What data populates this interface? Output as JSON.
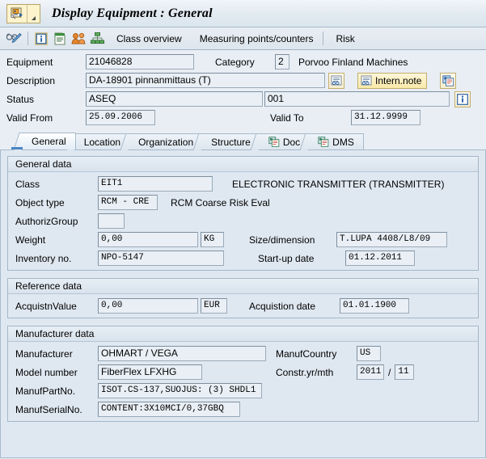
{
  "window": {
    "title": "Display Equipment : General",
    "system_icon": "sap-equipment-icon",
    "menu_arrow": "chevron-down-icon"
  },
  "toolbar": {
    "icons": [
      {
        "name": "glasses-pencil-icon",
        "label": "Display/Change"
      },
      {
        "name": "info-icon",
        "label": "Information"
      },
      {
        "name": "list-icon",
        "label": "List"
      },
      {
        "name": "partners-icon",
        "label": "Partners"
      },
      {
        "name": "structure-icon",
        "label": "Structure"
      }
    ],
    "buttons": [
      {
        "name": "class-overview-button",
        "label": "Class overview"
      },
      {
        "name": "measuring-points-button",
        "label": "Measuring points/counters"
      },
      {
        "name": "risk-button",
        "label": "Risk"
      }
    ]
  },
  "header": {
    "equipment_label": "Equipment",
    "equipment_value": "21046828",
    "category_label": "Category",
    "category_value": "2",
    "category_text": "Porvoo Finland Machines",
    "description_label": "Description",
    "description_value": "DA-18901 pinnanmittaus (T)",
    "description_icon": "long-text-icon",
    "intern_note_label": "Intern.note",
    "intern_note_icon": "long-text-icon",
    "multi_doc_icon": "multiple-documents-icon",
    "status_label": "Status",
    "status_value": "ASEQ",
    "status_number": "001",
    "status_info_icon": "info-icon",
    "valid_from_label": "Valid From",
    "valid_from_value": "25.09.2006",
    "valid_to_label": "Valid To",
    "valid_to_value": "31.12.9999"
  },
  "tabs": [
    {
      "label": "General",
      "active": true,
      "icon": null
    },
    {
      "label": "Location",
      "active": false,
      "icon": null
    },
    {
      "label": "Organization",
      "active": false,
      "icon": null
    },
    {
      "label": "Structure",
      "active": false,
      "icon": null
    },
    {
      "label": "Doc",
      "active": false,
      "icon": "document-icon"
    },
    {
      "label": "DMS",
      "active": false,
      "icon": "document-icon"
    }
  ],
  "general_data": {
    "title": "General data",
    "class_label": "Class",
    "class_value": "EIT1",
    "class_text": "ELECTRONIC TRANSMITTER (TRANSMITTER)",
    "object_type_label": "Object type",
    "object_type_value": "RCM - CRE",
    "object_type_text": "RCM Coarse Risk Eval",
    "authoriz_group_label": "AuthorizGroup",
    "authoriz_group_value": "",
    "weight_label": "Weight",
    "weight_value": "0,00",
    "weight_unit": "KG",
    "size_dimension_label": "Size/dimension",
    "size_dimension_value": "T.LUPA 4408/L8/09",
    "inventory_label": "Inventory no.",
    "inventory_value": "NPO-5147",
    "startup_label": "Start-up date",
    "startup_value": "01.12.2011"
  },
  "reference_data": {
    "title": "Reference data",
    "acquistn_value_label": "AcquistnValue",
    "acquistn_value": "0,00",
    "acquistn_currency": "EUR",
    "acquistion_date_label": "Acquistion date",
    "acquistion_date_value": "01.01.1900"
  },
  "manufacturer_data": {
    "title": "Manufacturer data",
    "manufacturer_label": "Manufacturer",
    "manufacturer_value": "OHMART / VEGA",
    "manuf_country_label": "ManufCountry",
    "manuf_country_value": "US",
    "model_number_label": "Model number",
    "model_number_value": "FiberFlex LFXHG",
    "constr_label": "Constr.yr/mth",
    "constr_year": "2011",
    "constr_sep": "/",
    "constr_month": "11",
    "manuf_part_label": "ManufPartNo.",
    "manuf_part_value": "ISOT.CS-137,SUOJUS: (3) SHDL1",
    "manuf_serial_label": "ManufSerialNo.",
    "manuf_serial_value": "CONTENT:3X10MCI/0,37GBQ"
  },
  "colors": {
    "accent": "#4b87c4",
    "panel_bg": "#dfe8f1",
    "field_bg": "#e9eff5",
    "highlight_yellow": "#f8e9a8"
  }
}
